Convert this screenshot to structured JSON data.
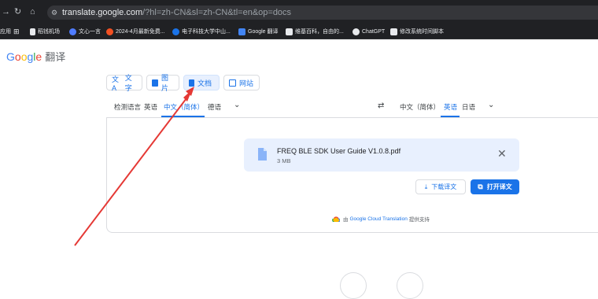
{
  "browser": {
    "url_host": "translate.google.com",
    "url_rest": "/?hl=zh-CN&sl=zh-CN&tl=en&op=docs",
    "bookmarks": [
      {
        "label": "应用",
        "color": ""
      },
      {
        "label": "稻钱机场",
        "color": "#e8eaed"
      },
      {
        "label": "文心一言",
        "color": "#4f7cff"
      },
      {
        "label": "2024-4月最新免费...",
        "color": "#f25022"
      },
      {
        "label": "电子科技大学中山...",
        "color": "#1a73e8"
      },
      {
        "label": "Google 翻译",
        "color": "#4285f4"
      },
      {
        "label": "维基百科，自由的...",
        "color": "#e8eaed"
      },
      {
        "label": "ChatGPT",
        "color": "#e8eaed"
      },
      {
        "label": "修改系统时间脚本",
        "color": "#e8eaed"
      }
    ]
  },
  "logo": {
    "g": "G",
    "o1": "o",
    "o2": "o",
    "g2": "g",
    "l": "l",
    "e": "e",
    "product": "翻译"
  },
  "modes": [
    {
      "label": "文字",
      "icon": "translate-icon"
    },
    {
      "label": "图片",
      "icon": "image-icon"
    },
    {
      "label": "文档",
      "icon": "document-icon"
    },
    {
      "label": "网站",
      "icon": "website-icon"
    }
  ],
  "source_langs": [
    "检测语言",
    "英语",
    "中文（简体）",
    "德语"
  ],
  "target_langs": [
    "中文（简体）",
    "英语",
    "日语"
  ],
  "file": {
    "name": "FREQ BLE SDK User Guide V1.0.8.pdf",
    "size": "3 MB"
  },
  "actions": {
    "download": "下载译文",
    "open": "打开译文"
  },
  "credit": {
    "prefix": "由",
    "link": "Google Cloud Translation",
    "suffix": "提供支持"
  },
  "colors": {
    "accent": "#1a73e8",
    "annotation_arrow": "#e53935"
  }
}
